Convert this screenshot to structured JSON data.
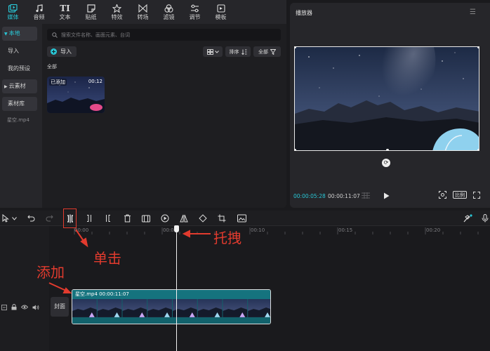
{
  "tabs": [
    {
      "label": "媒体",
      "icon": "media-icon"
    },
    {
      "label": "音频",
      "icon": "audio-icon"
    },
    {
      "label": "文本",
      "icon": "text-icon",
      "glyph": "TI"
    },
    {
      "label": "贴纸",
      "icon": "sticker-icon"
    },
    {
      "label": "特效",
      "icon": "effects-icon"
    },
    {
      "label": "转场",
      "icon": "transition-icon"
    },
    {
      "label": "滤镜",
      "icon": "filter-icon"
    },
    {
      "label": "调节",
      "icon": "adjust-icon"
    },
    {
      "label": "模板",
      "icon": "template-icon"
    }
  ],
  "nav": {
    "local": "本地",
    "import": "导入",
    "presets": "我的预设",
    "cloud": "云素材",
    "library": "素材库"
  },
  "media": {
    "search_placeholder": "搜索文件名称、画面元素、台词",
    "import_label": "导入",
    "sort_label": "排序",
    "all_label": "全部",
    "section_title": "全部",
    "clip": {
      "added": "已添加",
      "duration": "00:12",
      "name": "星空.mp4"
    }
  },
  "player": {
    "title": "播放器",
    "current_time": "00:00:05:28",
    "total_time": "00:00:11:07",
    "ratio_label": "比例"
  },
  "ruler": [
    "00:00",
    "00:05",
    "00:10",
    "00:15",
    "00:20"
  ],
  "track": {
    "cover_label": "封面",
    "clip_label": "星空.mp4   00:00:11:07"
  },
  "annotations": {
    "click": "单击",
    "drag": "托拽",
    "add": "添加"
  },
  "colors": {
    "accent": "#29c7d6",
    "annotation": "#e23b2e"
  }
}
